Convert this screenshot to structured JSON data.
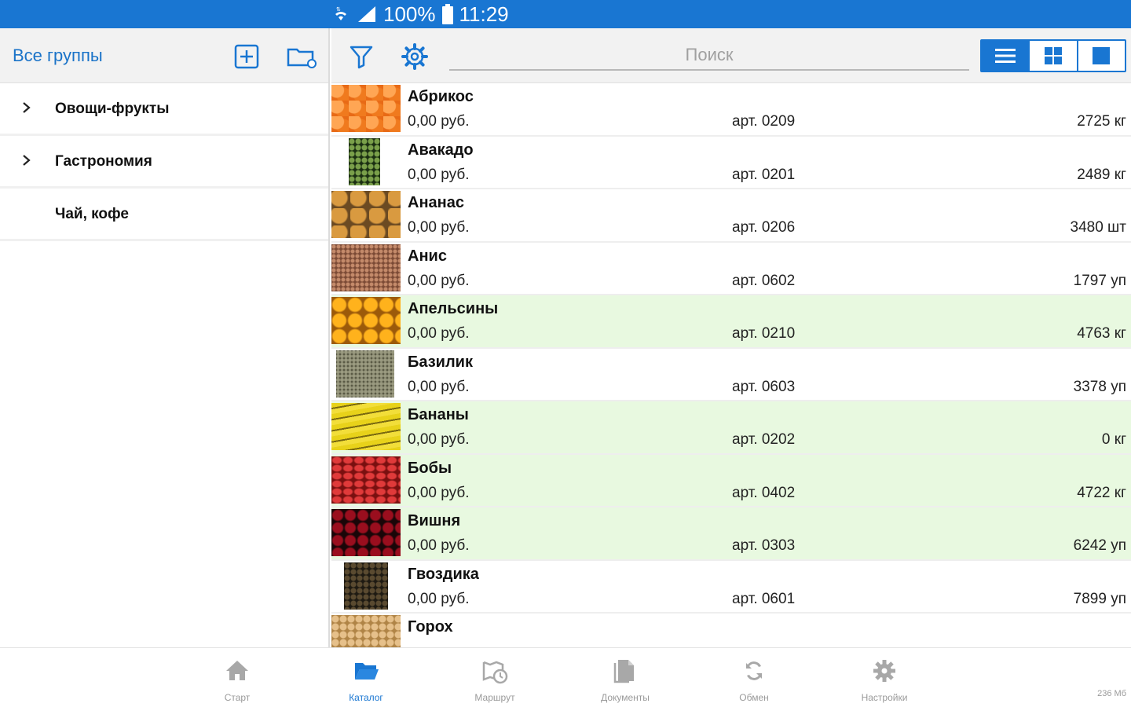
{
  "status_bar": {
    "battery": "100%",
    "time": "11:29"
  },
  "groups_panel": {
    "title": "Все группы",
    "items": [
      {
        "label": "Овощи-фрукты",
        "expandable": true
      },
      {
        "label": "Гастрономия",
        "expandable": true
      },
      {
        "label": "Чай, кофе",
        "expandable": false
      }
    ]
  },
  "toolbar": {
    "search_placeholder": "Поиск"
  },
  "products": [
    {
      "name": "Абрикос",
      "price": "0,00 руб.",
      "article": "арт. 0209",
      "qty": "2725 кг",
      "highlight": false,
      "thumb": "apricot"
    },
    {
      "name": "Авакадо",
      "price": "0,00 руб.",
      "article": "арт. 0201",
      "qty": "2489 кг",
      "highlight": false,
      "thumb": "avocado"
    },
    {
      "name": "Ананас",
      "price": "0,00 руб.",
      "article": "арт. 0206",
      "qty": "3480 шт",
      "highlight": false,
      "thumb": "pineapple"
    },
    {
      "name": "Анис",
      "price": "0,00 руб.",
      "article": "арт. 0602",
      "qty": "1797 уп",
      "highlight": false,
      "thumb": "anise"
    },
    {
      "name": "Апельсины",
      "price": "0,00 руб.",
      "article": "арт. 0210",
      "qty": "4763 кг",
      "highlight": true,
      "thumb": "orange"
    },
    {
      "name": "Базилик",
      "price": "0,00 руб.",
      "article": "арт. 0603",
      "qty": "3378 уп",
      "highlight": false,
      "thumb": "basil"
    },
    {
      "name": "Бананы",
      "price": "0,00 руб.",
      "article": "арт. 0202",
      "qty": "0 кг",
      "highlight": true,
      "thumb": "banana"
    },
    {
      "name": "Бобы",
      "price": "0,00 руб.",
      "article": "арт. 0402",
      "qty": "4722 кг",
      "highlight": true,
      "thumb": "beans"
    },
    {
      "name": "Вишня",
      "price": "0,00 руб.",
      "article": "арт. 0303",
      "qty": "6242 уп",
      "highlight": true,
      "thumb": "cherry"
    },
    {
      "name": "Гвоздика",
      "price": "0,00 руб.",
      "article": "арт. 0601",
      "qty": "7899 уп",
      "highlight": false,
      "thumb": "clove"
    },
    {
      "name": "Горох",
      "price": "",
      "article": "",
      "qty": "",
      "highlight": false,
      "thumb": "peas"
    }
  ],
  "bottom_nav": [
    {
      "label": "Старт",
      "icon": "home-icon",
      "active": false
    },
    {
      "label": "Каталог",
      "icon": "folder-open-icon",
      "active": true
    },
    {
      "label": "Маршрут",
      "icon": "map-clock-icon",
      "active": false
    },
    {
      "label": "Документы",
      "icon": "documents-icon",
      "active": false
    },
    {
      "label": "Обмен",
      "icon": "sync-icon",
      "active": false
    },
    {
      "label": "Настройки",
      "icon": "gear-icon",
      "active": false
    }
  ],
  "memory": "236 Мб",
  "colors": {
    "accent": "#1976d2",
    "highlight_row": "#e8f9e0",
    "status_bar": "#1976d2"
  }
}
